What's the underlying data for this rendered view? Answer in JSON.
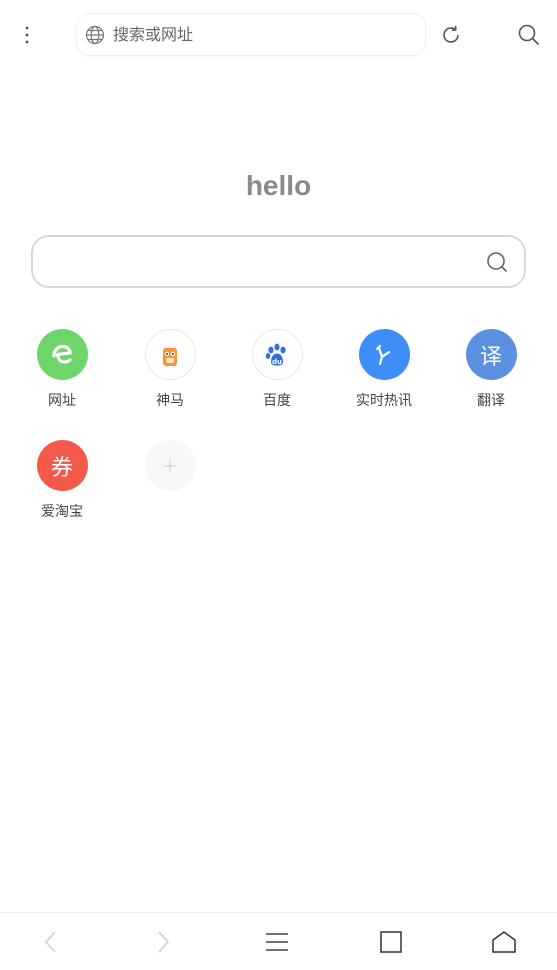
{
  "toolbar": {
    "url_placeholder": "搜索或网址"
  },
  "hello_text": "hello",
  "main_search": {
    "placeholder": ""
  },
  "shortcuts": [
    {
      "label": "网址",
      "icon": "e-browser-icon",
      "color": "#6dd56a"
    },
    {
      "label": "神马",
      "icon": "alpaca-icon",
      "color": "#ffffff"
    },
    {
      "label": "百度",
      "icon": "baidu-paw-icon",
      "color": "#ffffff"
    },
    {
      "label": "实时热讯",
      "icon": "hot-news-arrow-icon",
      "color": "#3e8ef7"
    },
    {
      "label": "翻译",
      "icon": "translate-icon",
      "color": "#5b8fe0",
      "glyph": "译"
    },
    {
      "label": "爱淘宝",
      "icon": "coupon-icon",
      "color": "#f35a4a",
      "glyph": "券"
    },
    {
      "label": "",
      "icon": "plus-icon",
      "color": "#f7f7f7"
    }
  ],
  "bottom_nav": {
    "icons": [
      "back-icon",
      "forward-icon",
      "menu-lines-icon",
      "tabs-square-icon",
      "home-icon"
    ]
  }
}
